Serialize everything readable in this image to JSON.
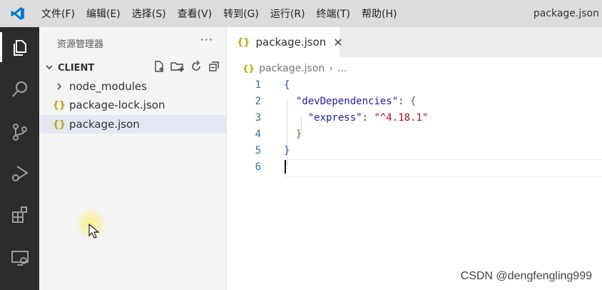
{
  "menubar": {
    "items": [
      "文件(F)",
      "编辑(E)",
      "选择(S)",
      "查看(V)",
      "转到(G)",
      "运行(R)",
      "终端(T)",
      "帮助(H)"
    ],
    "title": "package.json"
  },
  "activitybar": {
    "icons": [
      "explorer-icon",
      "search-icon",
      "source-control-icon",
      "run-debug-icon",
      "extensions-icon",
      "remote-explorer-icon"
    ]
  },
  "sidebar": {
    "header": "资源管理器",
    "more": "···",
    "section": "CLIENT",
    "items": [
      {
        "label": "node_modules",
        "icon": "chevron-right-icon"
      },
      {
        "label": "package-lock.json",
        "icon": "{}"
      },
      {
        "label": "package.json",
        "icon": "{}"
      }
    ]
  },
  "editor": {
    "tab": {
      "label": "package.json",
      "icon": "{}",
      "close": "✕"
    },
    "breadcrumb": {
      "icon": "{}",
      "file": "package.json",
      "sep": "›",
      "more": "..."
    },
    "line_numbers": [
      "1",
      "2",
      "3",
      "4",
      "5",
      "6"
    ],
    "code": {
      "open_brace": "{",
      "dev_key": "\"devDependencies\"",
      "colon": ": ",
      "inner_open": "{",
      "express_key": "\"express\"",
      "express_val": "\"^4.18.1\"",
      "inner_close": "}",
      "close_brace": "}"
    }
  },
  "watermark": "CSDN @dengfengling999",
  "colors": {
    "activitybar": "#2c2c2c",
    "sidebar": "#f4f4f4",
    "menubar": "#dcdcdc",
    "json_icon": "#b8a800",
    "vscode_blue": "#0a7ad1"
  }
}
